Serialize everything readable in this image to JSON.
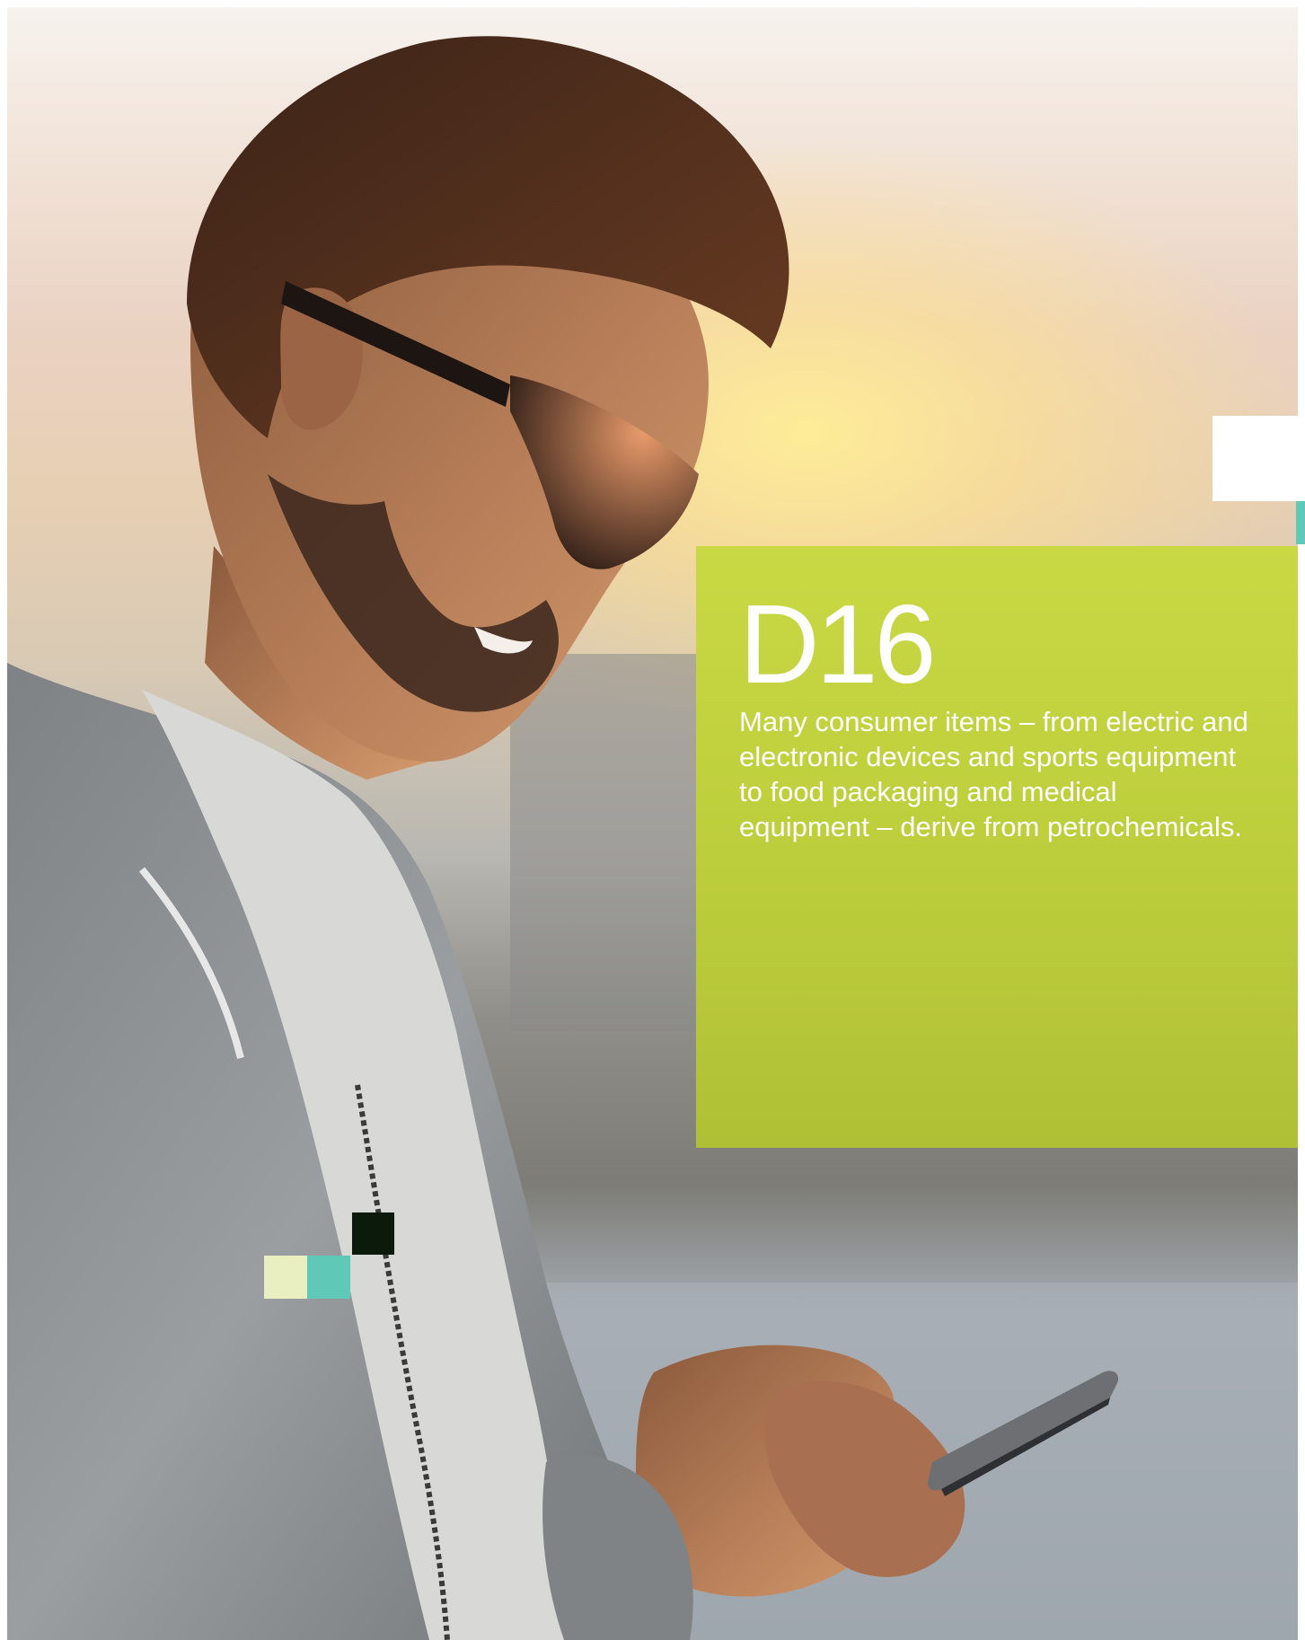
{
  "panel": {
    "code": "D16",
    "text": "Many consumer items – from electric and electronic devices and sports equipment to food packaging and medical equipment – derive from petrochemicals."
  },
  "colors": {
    "panel_green": "#c4d43f",
    "accent_teal": "#5fc8b7",
    "accent_cream": "#e9efc0",
    "accent_dark": "#0b1a0b",
    "text_white": "#ffffff"
  }
}
